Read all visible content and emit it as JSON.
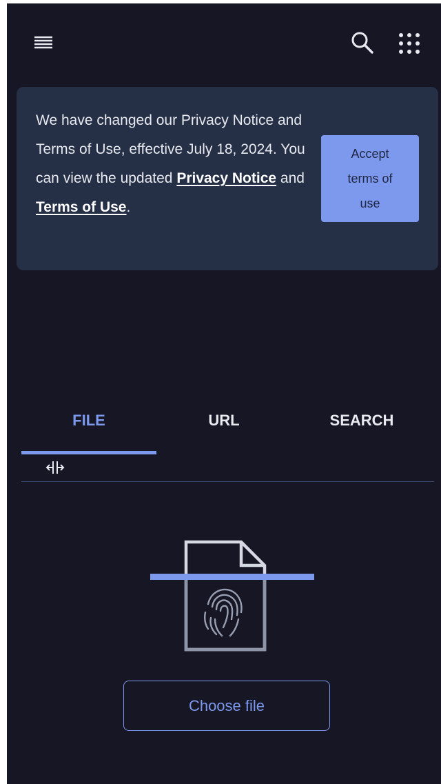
{
  "header": {
    "menu_icon": "hamburger-menu-icon",
    "search_icon": "search-icon",
    "apps_icon": "apps-grid-icon"
  },
  "notice": {
    "text_1": "We have changed our Privacy Notice and Terms of Use, effective July 18, 2024. You can view the updated ",
    "privacy_link": "Privacy Notice",
    "text_2": " and ",
    "terms_link": "Terms of Use",
    "text_3": ".",
    "accept_label": "Accept terms of use"
  },
  "tabs": [
    {
      "label": "FILE",
      "active": true
    },
    {
      "label": "URL",
      "active": false
    },
    {
      "label": "SEARCH",
      "active": false
    }
  ],
  "upload": {
    "illustration_icon": "fingerprint-file-scan-icon",
    "choose_label": "Choose file"
  },
  "colors": {
    "background": "#161625",
    "banner": "#252f45",
    "accent": "#7d99ee",
    "text": "#e8eaf0"
  }
}
